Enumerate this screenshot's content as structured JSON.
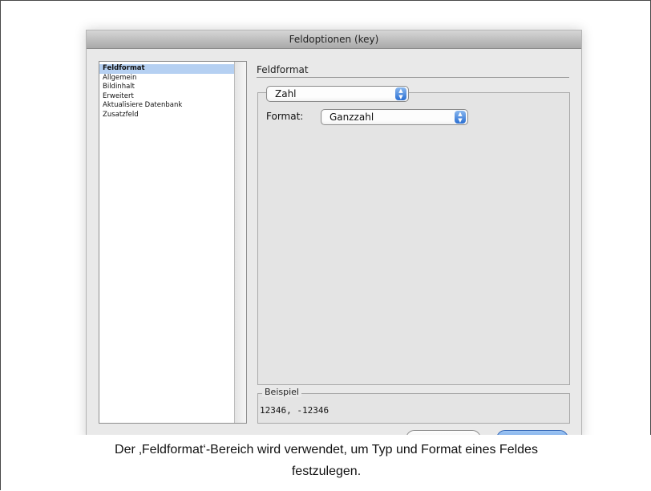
{
  "window": {
    "title": "Feldoptionen (key)"
  },
  "sidebar": {
    "items": [
      {
        "label": "Feldformat",
        "selected": true
      },
      {
        "label": "Allgemein",
        "selected": false
      },
      {
        "label": "Bildinhalt",
        "selected": false
      },
      {
        "label": "Erweitert",
        "selected": false
      },
      {
        "label": "Aktualisiere Datenbank",
        "selected": false
      },
      {
        "label": "Zusatzfeld",
        "selected": false
      }
    ]
  },
  "main": {
    "heading": "Feldformat",
    "type_popup": {
      "value": "Zahl"
    },
    "format": {
      "label": "Format:",
      "value": "Ganzzahl"
    },
    "example": {
      "title": "Beispiel",
      "value": "12346, -12346"
    }
  },
  "colors": {
    "selection": "#b5d0f2",
    "accent": "#2a6fd2"
  },
  "icons": {
    "popup_arrow": "up-down-arrows-icon"
  },
  "caption": {
    "line1": "Der ‚Feldformat‘-Bereich wird verwendet, um Typ und Format eines Feldes",
    "line2": "festzulegen."
  }
}
